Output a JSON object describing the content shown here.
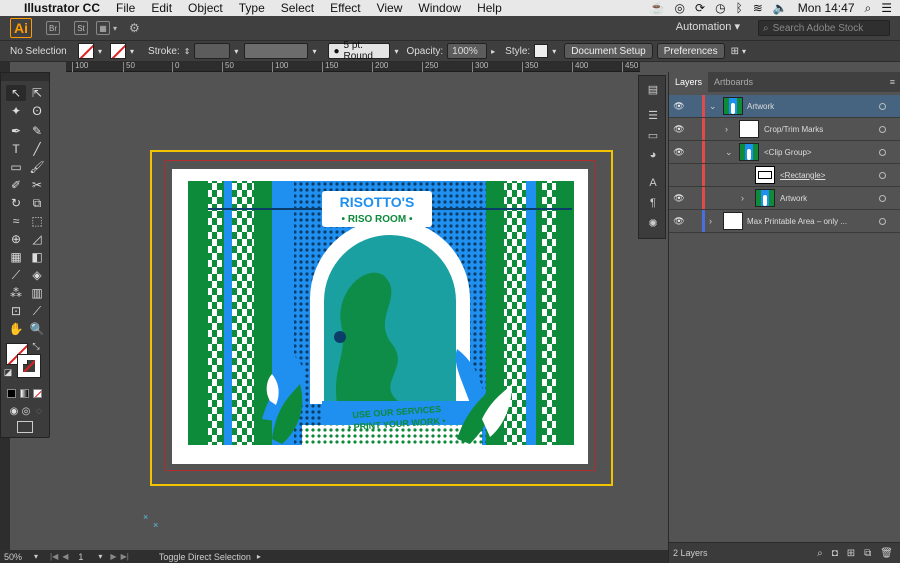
{
  "menubar": {
    "app_name": "Illustrator CC",
    "menus": [
      "File",
      "Edit",
      "Object",
      "Type",
      "Select",
      "Effect",
      "View",
      "Window",
      "Help"
    ],
    "clock": "Mon 14:47"
  },
  "appbar": {
    "workspace": "Automation",
    "search_placeholder": "Search Adobe Stock"
  },
  "controlbar": {
    "selection": "No Selection",
    "stroke_label": "Stroke:",
    "brush": "5 pt. Round",
    "opacity_label": "Opacity:",
    "opacity_value": "100%",
    "style_label": "Style:",
    "document_setup": "Document Setup",
    "preferences": "Preferences"
  },
  "ruler": {
    "ticks": [
      "100",
      "50",
      "0",
      "50",
      "100",
      "150",
      "200",
      "250",
      "300",
      "350",
      "400",
      "450"
    ]
  },
  "layers_panel": {
    "tabs": [
      "Layers",
      "Artboards"
    ],
    "rows": [
      {
        "name": "Artwork",
        "indent": 0,
        "expanded": true,
        "color": "#e04a4a",
        "thumb": "art"
      },
      {
        "name": "Crop/Trim Marks",
        "indent": 1,
        "expanded": false,
        "color": "#e04a4a",
        "thumb": "blank"
      },
      {
        "name": "<Clip Group>",
        "indent": 1,
        "expanded": true,
        "color": "#e04a4a",
        "thumb": "art"
      },
      {
        "name": "<Rectangle>",
        "indent": 2,
        "expanded": false,
        "color": "#e04a4a",
        "thumb": "rect"
      },
      {
        "name": "Artwork",
        "indent": 2,
        "expanded": false,
        "color": "#e04a4a",
        "thumb": "art"
      },
      {
        "name": "Max Printable Area – only ...",
        "indent": 0,
        "expanded": false,
        "color": "#4a6ee0",
        "thumb": "blank"
      }
    ],
    "footer": "2 Layers"
  },
  "artwork": {
    "title_line1": "RISOTTO'S",
    "title_line2": "• RISO ROOM •",
    "banner_line1": "USE OUR SERVICES",
    "banner_line2": "• PRINT YOUR WORK •",
    "green": "#0d8a3a",
    "blue": "#1f8ff0"
  },
  "statusbar": {
    "zoom": "50%",
    "page": "1",
    "status": "Toggle Direct Selection"
  }
}
